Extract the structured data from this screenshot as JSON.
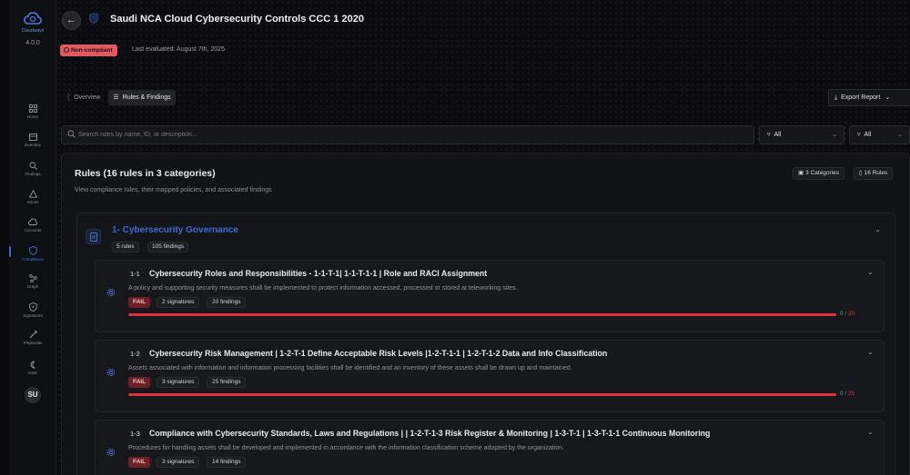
{
  "app": {
    "brand": "Cloudways",
    "version": "4.0.0",
    "avatar_initials": "SU"
  },
  "sidebar": {
    "items": [
      {
        "label": "Home",
        "icon": "grid-icon",
        "active": false
      },
      {
        "label": "Inventory",
        "icon": "calendar-icon",
        "active": false
      },
      {
        "label": "Findings",
        "icon": "search-icon",
        "active": false
      },
      {
        "label": "Issues",
        "icon": "warning-icon",
        "active": false
      },
      {
        "label": "Accounts",
        "icon": "cloud-icon",
        "active": false
      },
      {
        "label": "Compliance",
        "icon": "shield-icon",
        "active": true
      },
      {
        "label": "Graph",
        "icon": "graph-icon",
        "active": false
      },
      {
        "label": "Signatures",
        "icon": "signature-icon",
        "active": false
      },
      {
        "label": "Playbooks",
        "icon": "playbook-icon",
        "active": false
      },
      {
        "label": "Dark",
        "icon": "moon-icon",
        "active": false
      }
    ]
  },
  "header": {
    "title": "Saudi NCA Cloud Cybersecurity Controls CCC 1 2020",
    "status": "Non-compliant",
    "last_evaluated": "Last evaluated: August 7th, 2025"
  },
  "tabs": [
    {
      "label": "Overview",
      "active": false
    },
    {
      "label": "Rules & Findings",
      "active": true
    }
  ],
  "toolbar": {
    "export_label": "Export Report",
    "search_placeholder": "Search rules by name, ID, or description...",
    "filter1": "All",
    "filter2": "All"
  },
  "rules_panel": {
    "title": "Rules (16 rules in 3 categories)",
    "subtitle": "View compliance rules, their mapped policies, and associated findings",
    "categories_pill": "3 Categories",
    "rules_pill": "16 Rules"
  },
  "category": {
    "title": "1- Cybersecurity Governance",
    "rules_count": "5 rules",
    "findings_count": "105 findings"
  },
  "rules": [
    {
      "num": "1-1",
      "title": "Cybersecurity Roles and Responsibilities - 1-1-T-1| 1-1-T-1-1 | Role and RACI Assignment",
      "description": "A policy and supporting security measures shall be implemented to protect information accessed, processed or stored at teleworking sites.",
      "status": "FAIL",
      "signatures": "2 signatures",
      "findings": "20 findings",
      "passed": "0",
      "total": "20",
      "fail_fraction": 1.0
    },
    {
      "num": "1-2",
      "title": "Cybersecurity Risk Management | 1-2-T-1 Define Acceptable Risk Levels |1-2-T-1-1 | 1-2-T-1-2 Data and Info Classification",
      "description": "Assets associated with information and information processing facilities shall be identified and an inventory of these assets shall be drawn up and maintained.",
      "status": "FAIL",
      "signatures": "3 signatures",
      "findings": "25 findings",
      "passed": "0",
      "total": "25",
      "fail_fraction": 1.0
    },
    {
      "num": "1-3",
      "title": "Compliance with Cybersecurity Standards, Laws and Regulations | | 1-2-T-1-3 Risk Register & Monitoring | 1-3-T-1 | 1-3-T-1-1 Continuous Monitoring",
      "description": "Procedures for handling assets shall be developed and implemented in accordance with the information classification scheme adopted by the organization.",
      "status": "FAIL",
      "signatures": "3 signatures",
      "findings": "14 findings"
    }
  ],
  "colors": {
    "accent": "#3f6ad6",
    "fail": "#e0313d",
    "pass": "#3fb26a",
    "status_badge": "#e05a66"
  }
}
